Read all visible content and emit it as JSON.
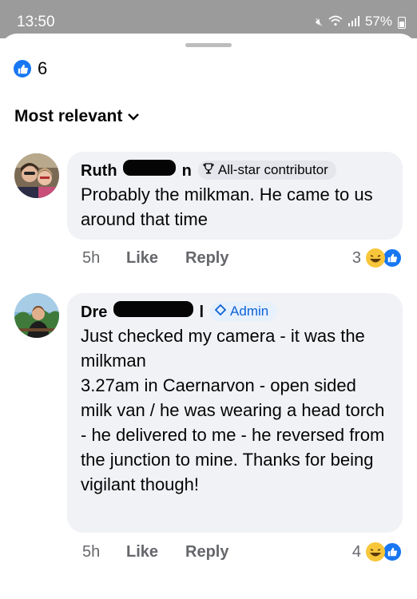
{
  "status_bar": {
    "time": "13:50",
    "battery": "57%"
  },
  "reactions_summary": {
    "count": "6"
  },
  "sort": {
    "label": "Most relevant"
  },
  "comments": [
    {
      "name_prefix": "Ruth",
      "name_suffix": "n",
      "badge": "All-star contributor",
      "text": "Probably the milkman. He came to us around that time",
      "time": "5h",
      "like_label": "Like",
      "reply_label": "Reply",
      "reaction_count": "3"
    },
    {
      "name_prefix": "Dre",
      "name_suffix": "l",
      "badge": "Admin",
      "text": "Just checked my camera - it was the milkman\n3.27am in Caernarvon - open sided milk van / he was wearing a head torch - he delivered to me - he reversed from the junction to mine. Thanks for being vigilant though!",
      "time": "5h",
      "like_label": "Like",
      "reply_label": "Reply",
      "reaction_count": "4"
    }
  ]
}
